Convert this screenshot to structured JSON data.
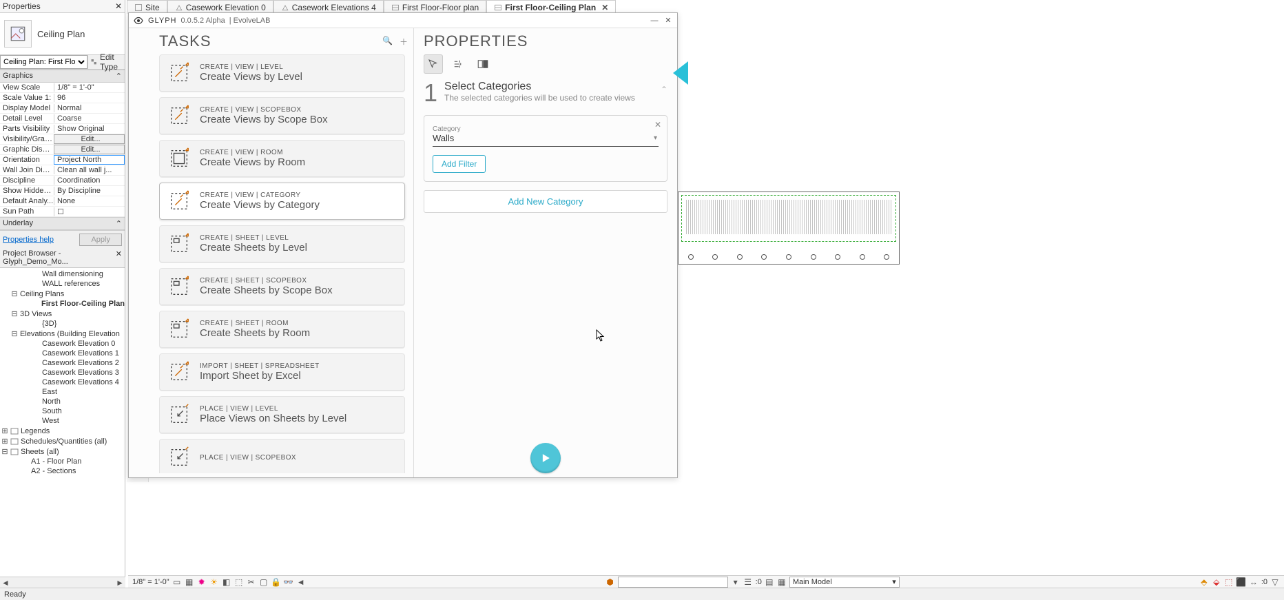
{
  "tabs": [
    {
      "label": "Site",
      "icon": "site"
    },
    {
      "label": "Casework  Elevation 0",
      "icon": "elev"
    },
    {
      "label": "Casework Elevations 4",
      "icon": "elev"
    },
    {
      "label": "First Floor-Floor plan",
      "icon": "plan"
    },
    {
      "label": "First Floor-Ceiling Plan",
      "icon": "plan",
      "active": true,
      "closable": true
    }
  ],
  "propertiesPanel": {
    "title": "Properties",
    "typeName": "Ceiling Plan",
    "typeSelector": "Ceiling Plan: First Flo",
    "editType": "Edit Type",
    "section1": "Graphics",
    "section2": "Underlay",
    "rows": [
      {
        "k": "View Scale",
        "v": " 1/8\" = 1'-0\""
      },
      {
        "k": "Scale Value    1:",
        "v": "96"
      },
      {
        "k": "Display Model",
        "v": "Normal"
      },
      {
        "k": "Detail Level",
        "v": "Coarse"
      },
      {
        "k": "Parts Visibility",
        "v": "Show Original"
      },
      {
        "k": "Visibility/Grap...",
        "v": "Edit...",
        "btn": true
      },
      {
        "k": "Graphic Displ...",
        "v": "Edit...",
        "btn": true
      },
      {
        "k": "Orientation",
        "v": "Project North",
        "sel": true
      },
      {
        "k": "Wall Join Disp...",
        "v": "Clean all wall j..."
      },
      {
        "k": "Discipline",
        "v": "Coordination"
      },
      {
        "k": "Show Hidden ...",
        "v": "By Discipline"
      },
      {
        "k": "Default Analy...",
        "v": "None"
      },
      {
        "k": "Sun Path",
        "v": "☐"
      }
    ],
    "helpLink": "Properties help",
    "apply": "Apply"
  },
  "projectBrowser": {
    "title": "Project Browser - Glyph_Demo_Mo...",
    "nodes": [
      {
        "label": "Wall dimensioning",
        "indent": 3
      },
      {
        "label": "WALL references",
        "indent": 3
      },
      {
        "label": "Ceiling Plans",
        "indent": 1,
        "exp": "-"
      },
      {
        "label": "First Floor-Ceiling Plan",
        "indent": 3,
        "bold": true
      },
      {
        "label": "3D Views",
        "indent": 1,
        "exp": "-"
      },
      {
        "label": "{3D}",
        "indent": 3
      },
      {
        "label": "Elevations (Building Elevation",
        "indent": 1,
        "exp": "-"
      },
      {
        "label": "Casework  Elevation 0",
        "indent": 3
      },
      {
        "label": "Casework Elevations 1",
        "indent": 3
      },
      {
        "label": "Casework Elevations 2",
        "indent": 3
      },
      {
        "label": "Casework Elevations 3",
        "indent": 3
      },
      {
        "label": "Casework Elevations 4",
        "indent": 3
      },
      {
        "label": "East",
        "indent": 3
      },
      {
        "label": "North",
        "indent": 3
      },
      {
        "label": "South",
        "indent": 3
      },
      {
        "label": "West",
        "indent": 3
      },
      {
        "label": "Legends",
        "indent": 0,
        "exp": "+",
        "ico": true
      },
      {
        "label": "Schedules/Quantities (all)",
        "indent": 0,
        "exp": "+",
        "ico": true
      },
      {
        "label": "Sheets (all)",
        "indent": 0,
        "exp": "-",
        "ico": true
      },
      {
        "label": "A1 - Floor Plan",
        "indent": 2
      },
      {
        "label": "A2 - Sections",
        "indent": 2
      }
    ]
  },
  "glyph": {
    "app": "GLYPH",
    "version": "0.0.5.2 Alpha",
    "vendor": "| EvolveLAB",
    "tasksHeader": "TASKS",
    "propsHeader": "PROPERTIES",
    "tasks": [
      {
        "bc": "CREATE  |  VIEW  |  LEVEL",
        "t": "Create Views by Level",
        "icon": "view"
      },
      {
        "bc": "CREATE  |  VIEW  |  SCOPEBOX",
        "t": "Create Views by Scope Box",
        "icon": "view"
      },
      {
        "bc": "CREATE  |  VIEW  |  ROOM",
        "t": "Create Views by Room",
        "icon": "room"
      },
      {
        "bc": "CREATE  |  VIEW  |  CATEGORY",
        "t": "Create Views by Category",
        "icon": "view",
        "selected": true
      },
      {
        "bc": "CREATE  |  SHEET  |  LEVEL",
        "t": "Create Sheets by Level",
        "icon": "sheet"
      },
      {
        "bc": "CREATE  |  SHEET  |  SCOPEBOX",
        "t": "Create Sheets by Scope Box",
        "icon": "sheet"
      },
      {
        "bc": "CREATE  |  SHEET  |  ROOM",
        "t": "Create Sheets by Room",
        "icon": "sheet"
      },
      {
        "bc": "IMPORT  |  SHEET  |  SPREADSHEET",
        "t": "Import Sheet by Excel",
        "icon": "view"
      },
      {
        "bc": "PLACE  |  VIEW  |  LEVEL",
        "t": "Place Views on Sheets by Level",
        "icon": "place"
      },
      {
        "bc": "PLACE  |  VIEW  |  SCOPEBOX",
        "t": "",
        "icon": "place"
      }
    ],
    "step": {
      "num": "1",
      "title": "Select Categories",
      "sub": "The selected categories will be used to create views"
    },
    "category": {
      "label": "Category",
      "value": "Walls"
    },
    "addFilter": "Add Filter",
    "addCategory": "Add New Category"
  },
  "bottom": {
    "scale": "1/8\" = 1'-0\"",
    "zero": ":0",
    "mainModel": "Main Model",
    "ratio": ":0"
  },
  "status": "Ready"
}
